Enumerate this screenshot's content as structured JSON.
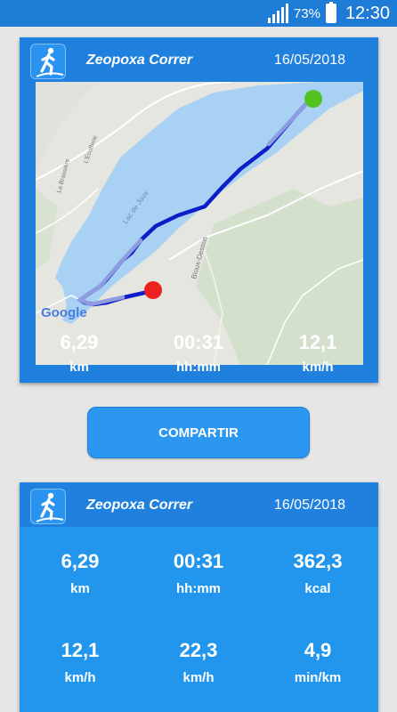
{
  "status": {
    "battery_pct": "73%",
    "time": "12:30",
    "icons": [
      "signal-icon",
      "battery-icon"
    ]
  },
  "activity": {
    "app_name": "Zeopoxa Correr",
    "date": "16/05/2018"
  },
  "map": {
    "labels": {
      "lake": "Lac de Joux",
      "brassus": "Bioux-Dessus",
      "brassiere": "La Brassière",
      "abbaye": "L'Écofferie",
      "google": "Google"
    },
    "colors": {
      "track": "#0b1ec8",
      "start": "#52c31e",
      "end": "#ee2121"
    }
  },
  "summary": [
    {
      "value": "6,29",
      "unit": "km"
    },
    {
      "value": "00:31",
      "unit": "hh:mm"
    },
    {
      "value": "12,1",
      "unit": "km/h"
    }
  ],
  "share_label": "COMPARTIR",
  "details": [
    {
      "value": "6,29",
      "unit": "km"
    },
    {
      "value": "00:31",
      "unit": "hh:mm"
    },
    {
      "value": "362,3",
      "unit": "kcal"
    },
    {
      "value": "12,1",
      "unit": "km/h"
    },
    {
      "value": "22,3",
      "unit": "km/h"
    },
    {
      "value": "4,9",
      "unit": "min/km"
    }
  ],
  "colors": {
    "header": "#1f80dd",
    "accent": "#2196ec",
    "statusbar": "#1e7bd6"
  }
}
